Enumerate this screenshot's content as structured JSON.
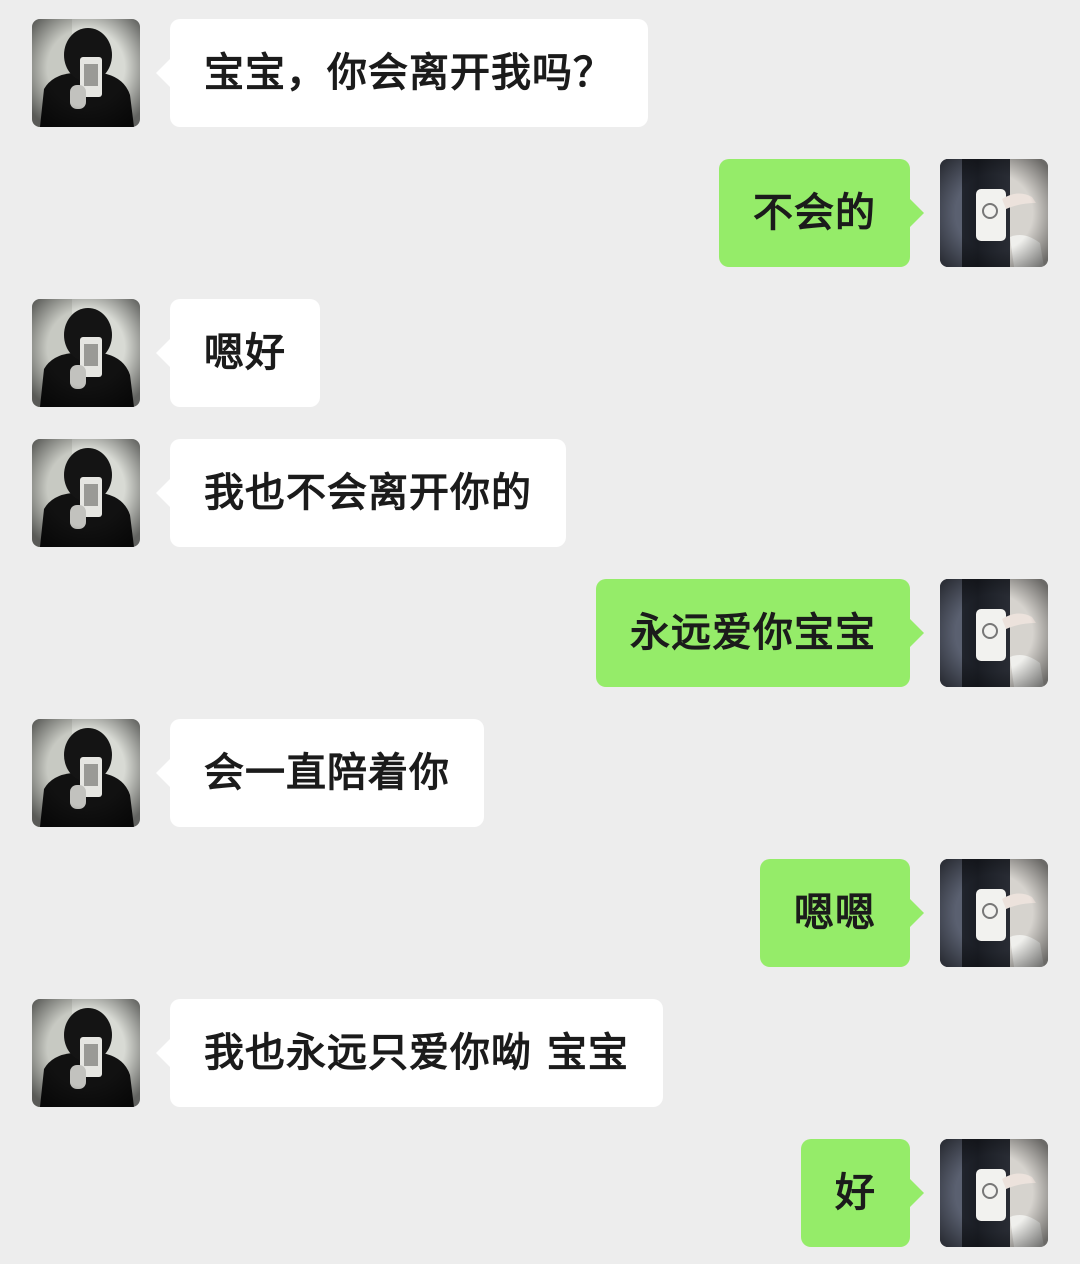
{
  "conversation": {
    "messages": [
      {
        "sender": "other",
        "avatar": "avatar-other-icon",
        "text": "宝宝，你会离开我吗？"
      },
      {
        "sender": "self",
        "avatar": "avatar-self-icon",
        "text": "不会的"
      },
      {
        "sender": "other",
        "avatar": "avatar-other-icon",
        "text": "嗯好"
      },
      {
        "sender": "other",
        "avatar": "avatar-other-icon",
        "text": "我也不会离开你的"
      },
      {
        "sender": "self",
        "avatar": "avatar-self-icon",
        "text": "永远爱你宝宝"
      },
      {
        "sender": "other",
        "avatar": "avatar-other-icon",
        "text": "会一直陪着你"
      },
      {
        "sender": "self",
        "avatar": "avatar-self-icon",
        "text": "嗯嗯"
      },
      {
        "sender": "other",
        "avatar": "avatar-other-icon",
        "text": "我也永远只爱你呦 宝宝"
      },
      {
        "sender": "self",
        "avatar": "avatar-self-icon",
        "text": "好"
      }
    ]
  },
  "colors": {
    "background": "#ededed",
    "incoming_bubble": "#ffffff",
    "outgoing_bubble": "#95ec69",
    "text": "#1b1b1b"
  }
}
